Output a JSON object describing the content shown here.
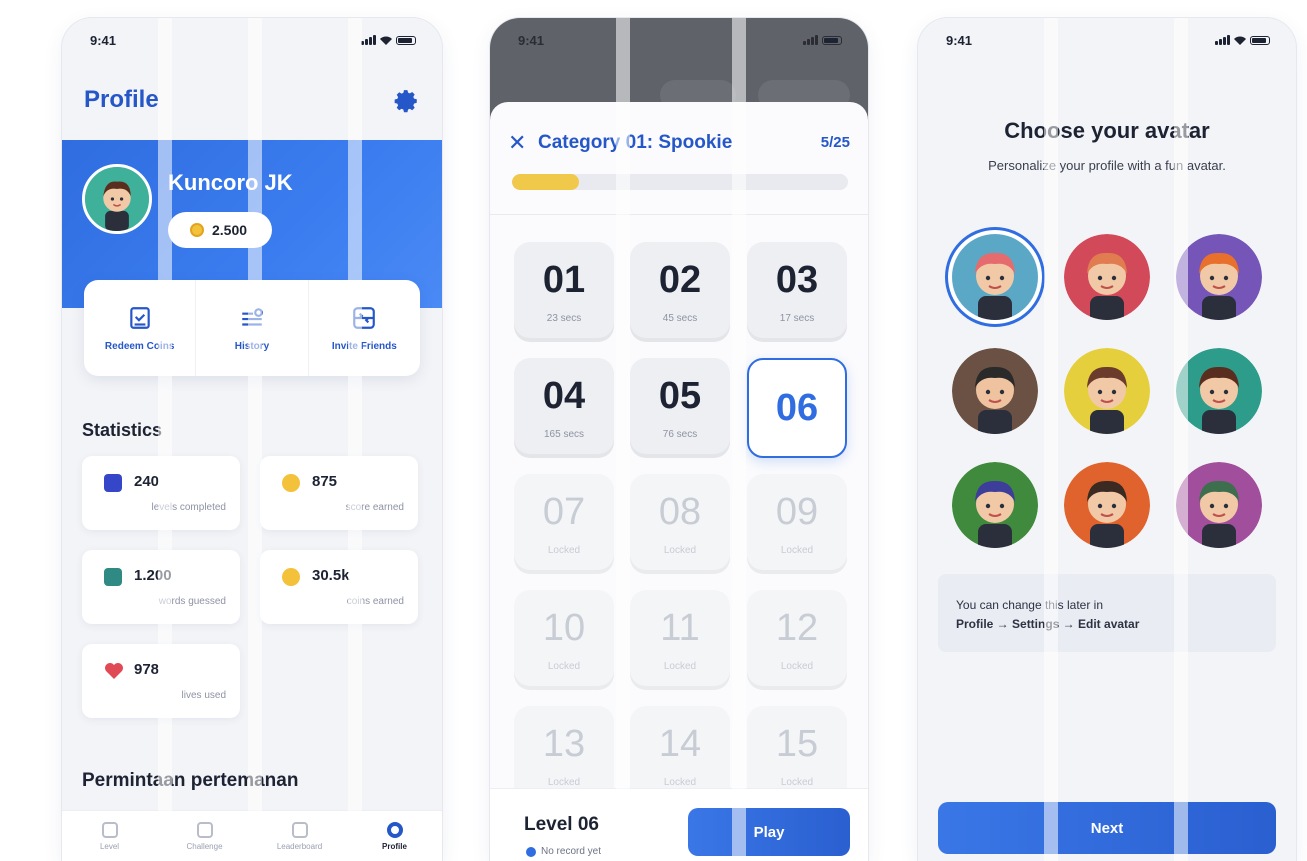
{
  "status_time": "9:41",
  "profile": {
    "title": "Profile",
    "name": "Kuncoro JK",
    "coins": "2.500",
    "actions": [
      {
        "label": "Redeem Coins",
        "icon": "redeem-icon"
      },
      {
        "label": "History",
        "icon": "history-icon"
      },
      {
        "label": "Invite Friends",
        "icon": "invite-icon"
      }
    ],
    "statistics_title": "Statistics",
    "stats": [
      {
        "value": "240",
        "label": "levels completed",
        "icon": "chart-icon",
        "color": "#3547c8"
      },
      {
        "value": "875",
        "label": "score earned",
        "icon": "coin-icon",
        "color": "#f3c13a"
      },
      {
        "value": "1.200",
        "label": "words guessed",
        "icon": "letter-a-icon",
        "color": "#2e8a82"
      },
      {
        "value": "30.5k",
        "label": "coins earned",
        "icon": "coin-icon",
        "color": "#f3c13a"
      },
      {
        "value": "978",
        "label": "lives used",
        "icon": "heart-icon",
        "color": "#e04a55"
      }
    ],
    "friends_title": "Permintaan pertemanan",
    "tabs": [
      "Level",
      "Challenge",
      "Leaderboard",
      "Profile"
    ]
  },
  "level_select": {
    "category": "Category 01: Spookie",
    "progress_label": "5/25",
    "progress_fraction": 0.2,
    "levels": [
      {
        "num": "01",
        "sub": "23 secs",
        "state": "done"
      },
      {
        "num": "02",
        "sub": "45 secs",
        "state": "done"
      },
      {
        "num": "03",
        "sub": "17 secs",
        "state": "done"
      },
      {
        "num": "04",
        "sub": "165 secs",
        "state": "done"
      },
      {
        "num": "05",
        "sub": "76 secs",
        "state": "done"
      },
      {
        "num": "06",
        "sub": "",
        "state": "selected"
      },
      {
        "num": "07",
        "sub": "Locked",
        "state": "locked"
      },
      {
        "num": "08",
        "sub": "Locked",
        "state": "locked"
      },
      {
        "num": "09",
        "sub": "Locked",
        "state": "locked"
      },
      {
        "num": "10",
        "sub": "Locked",
        "state": "locked"
      },
      {
        "num": "11",
        "sub": "Locked",
        "state": "locked"
      },
      {
        "num": "12",
        "sub": "Locked",
        "state": "locked"
      },
      {
        "num": "13",
        "sub": "Locked",
        "state": "locked"
      },
      {
        "num": "14",
        "sub": "Locked",
        "state": "locked"
      },
      {
        "num": "15",
        "sub": "Locked",
        "state": "locked"
      }
    ],
    "footer_level": "Level 06",
    "footer_record": "No record yet",
    "play_label": "Play"
  },
  "avatar": {
    "title": "Choose your avatar",
    "subtitle": "Personalize your profile with a fun avatar.",
    "avatars": [
      {
        "bg": "#5aa8c6",
        "hair": "#e56b6f",
        "skin": "#f2c9a6",
        "name": "avatar-girl-pink"
      },
      {
        "bg": "#d24a5a",
        "hair": "#e07c50",
        "skin": "#f2c9a6",
        "name": "avatar-boy-cap"
      },
      {
        "bg": "#7556b8",
        "hair": "#e86f2c",
        "skin": "#f2c9a6",
        "name": "avatar-boy-ginger"
      },
      {
        "bg": "#6b5144",
        "hair": "#2a2a2a",
        "skin": "#f0c3a0",
        "name": "avatar-cool-sunglasses"
      },
      {
        "bg": "#e6cf3c",
        "hair": "#6b3b2b",
        "skin": "#f2c9a6",
        "name": "avatar-girl-brown"
      },
      {
        "bg": "#2e9c8a",
        "hair": "#5a2e1e",
        "skin": "#f2c9a6",
        "name": "avatar-boy-teal"
      },
      {
        "bg": "#3f8a3c",
        "hair": "#3d3e9a",
        "skin": "#f2c9a6",
        "name": "avatar-hijab-blue"
      },
      {
        "bg": "#e0632e",
        "hair": "#3a2a22",
        "skin": "#f2c9a6",
        "name": "avatar-hat-glasses"
      },
      {
        "bg": "#a14f9c",
        "hair": "#3d6e4d",
        "skin": "#f2c9a6",
        "name": "avatar-hijab-green"
      }
    ],
    "note_line1": "You can change this later in",
    "note_line2": "Profile → Settings → Edit avatar",
    "next_label": "Next"
  }
}
